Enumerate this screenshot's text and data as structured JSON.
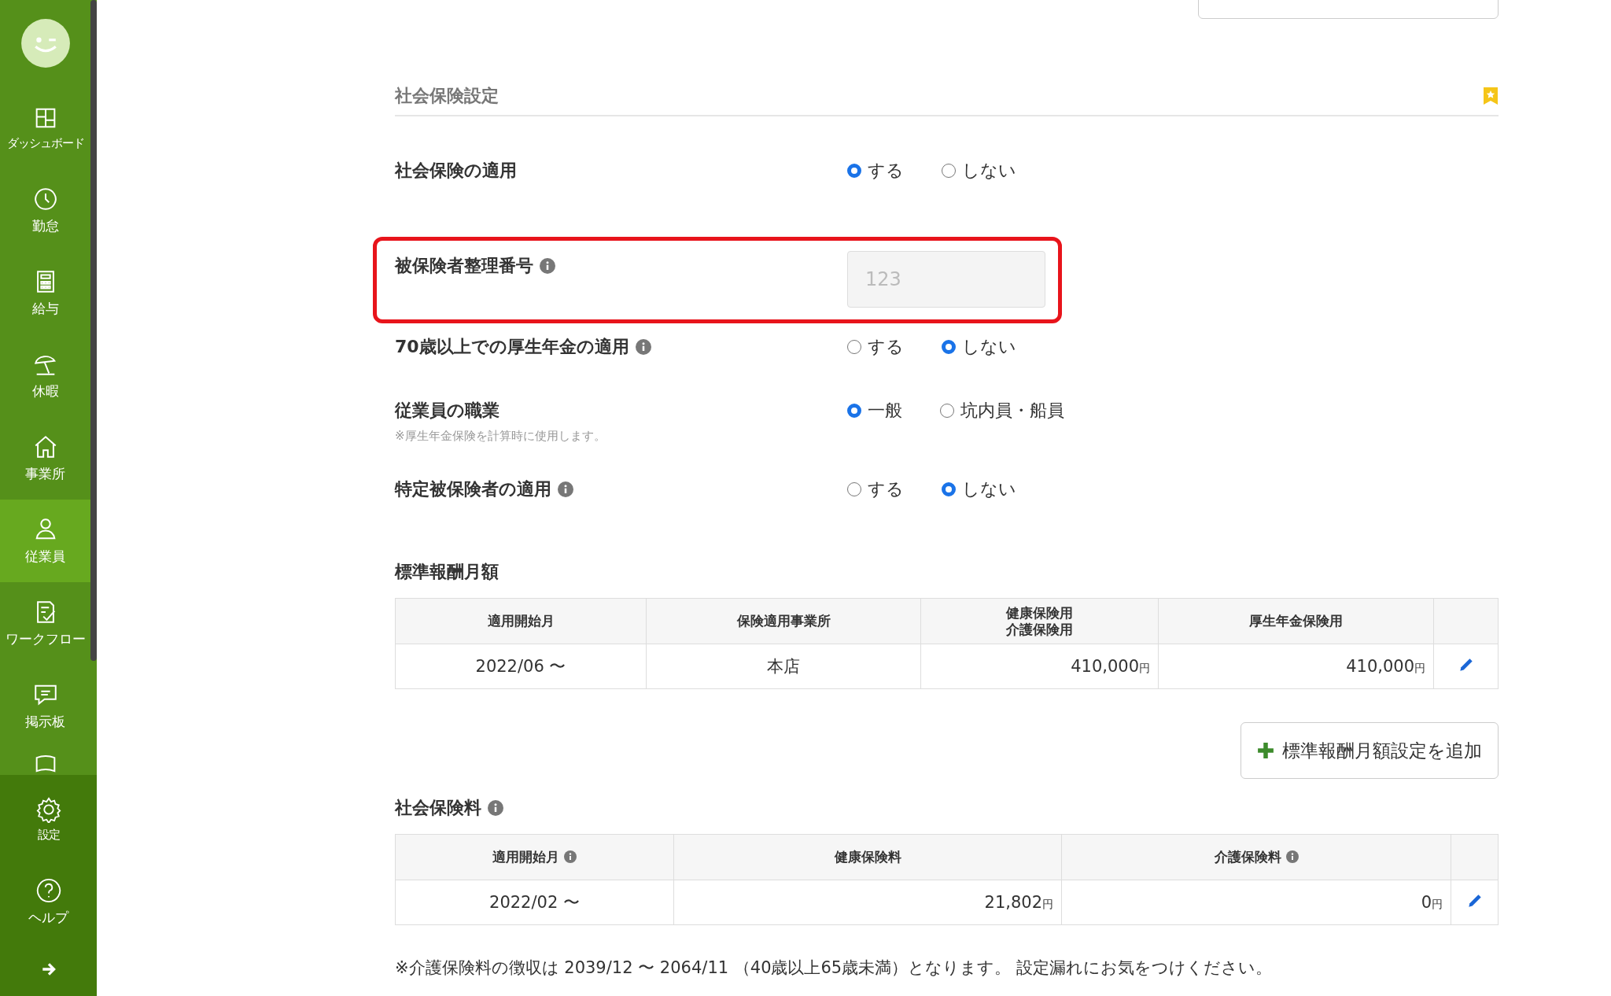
{
  "sidebar": {
    "items": [
      {
        "label": "ダッシュボード",
        "selected": false
      },
      {
        "label": "勤怠",
        "selected": false
      },
      {
        "label": "給与",
        "selected": false
      },
      {
        "label": "休暇",
        "selected": false
      },
      {
        "label": "事業所",
        "selected": false
      },
      {
        "label": "従業員",
        "selected": true
      },
      {
        "label": "ワークフロー",
        "selected": false
      },
      {
        "label": "掲示板",
        "selected": false
      }
    ],
    "bottom_items": [
      {
        "label": "設定"
      },
      {
        "label": "ヘルプ"
      }
    ]
  },
  "section": {
    "title": "社会保険設定"
  },
  "settings": [
    {
      "kind": "radio",
      "label": "社会保険の適用",
      "options": [
        {
          "label": "する",
          "selected": true
        },
        {
          "label": "しない",
          "selected": false
        }
      ]
    },
    {
      "kind": "field",
      "label": "被保険者整理番号",
      "info": true,
      "placeholder": "123",
      "highlighted": true
    },
    {
      "kind": "radio",
      "label": "70歳以上での厚生年金の適用",
      "info": true,
      "options": [
        {
          "label": "する",
          "selected": false
        },
        {
          "label": "しない",
          "selected": true
        }
      ]
    },
    {
      "kind": "radio",
      "label": "従業員の職業",
      "note": "※厚生年金保険を計算時に使用します。",
      "options": [
        {
          "label": "一般",
          "selected": true
        },
        {
          "label": "坑内員・船員",
          "selected": false
        }
      ]
    },
    {
      "kind": "radio",
      "label": "特定被保険者の適用",
      "info": true,
      "options": [
        {
          "label": "する",
          "selected": false
        },
        {
          "label": "しない",
          "selected": true
        }
      ]
    }
  ],
  "standard_remuneration": {
    "title": "標準報酬月額",
    "columns": [
      {
        "lines": [
          "適用開始月"
        ]
      },
      {
        "lines": [
          "保険適用事業所"
        ]
      },
      {
        "lines": [
          "健康保険用",
          "介護保険用"
        ]
      },
      {
        "lines": [
          "厚生年金保険用"
        ]
      }
    ],
    "rows": [
      [
        {
          "text": "2022/06 〜"
        },
        {
          "text": "本店"
        },
        {
          "text": "410,000",
          "unit": "円"
        },
        {
          "text": "410,000",
          "unit": "円"
        }
      ]
    ],
    "add_button": "標準報酬月額設定を追加"
  },
  "premiums": {
    "title": "社会保険料",
    "columns": [
      {
        "lines": [
          "適用開始月"
        ],
        "info": true
      },
      {
        "lines": [
          "健康保険料"
        ]
      },
      {
        "lines": [
          "介護保険料"
        ],
        "info": true
      }
    ],
    "rows": [
      [
        {
          "text": "2022/02 〜"
        },
        {
          "text": "21,802",
          "unit": "円"
        },
        {
          "text": "0",
          "unit": "円"
        }
      ]
    ]
  },
  "footer_note": "※介護保険料の徴収は 2039/12 〜 2064/11 （40歳以上65歳未満）となります。 設定漏れにお気をつけください。"
}
